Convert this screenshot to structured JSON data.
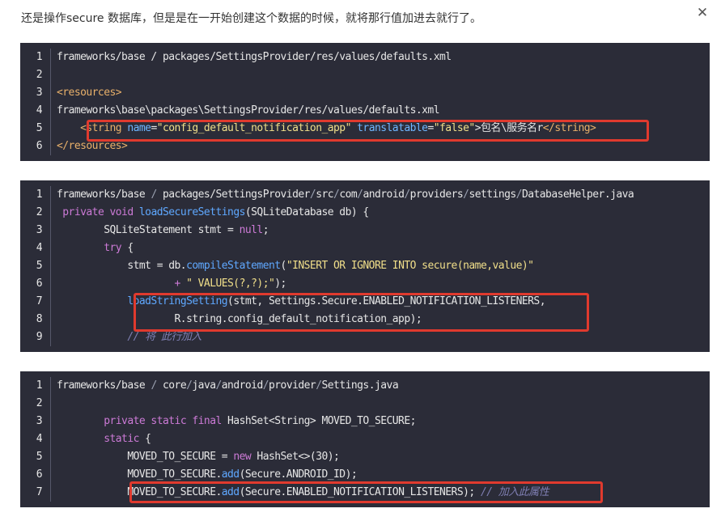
{
  "intro_text": "还是操作secure 数据库，但是是在一开始创建这个数据的时候，就将那行值加进去就行了。",
  "close_icon_glyph": "✕",
  "colors": {
    "code_bg": "#2b2c38",
    "highlight_border": "#e03a2e",
    "keyword": "#cc7ad6",
    "function": "#5fa8ff",
    "string": "#f1df8a",
    "comment": "#7f7fb3"
  },
  "blocks": [
    {
      "lines": [
        {
          "n": "1",
          "tokens": [
            {
              "t": "frameworks/base / packages/SettingsProvider/res/values/defaults.xml",
              "c": "t"
            }
          ]
        },
        {
          "n": "2",
          "tokens": []
        },
        {
          "n": "3",
          "tokens": [
            {
              "t": "<resources>",
              "c": "tag"
            }
          ]
        },
        {
          "n": "4",
          "tokens": [
            {
              "t": "frameworks\\base\\packages\\SettingsProvider/res/values/defaults.xml",
              "c": "t"
            }
          ]
        },
        {
          "n": "5",
          "tokens": [
            {
              "t": "    ",
              "c": "t"
            },
            {
              "t": "<string ",
              "c": "tag"
            },
            {
              "t": "name",
              "c": "at"
            },
            {
              "t": "=",
              "c": "t"
            },
            {
              "t": "\"config_default_notification_app\"",
              "c": "str"
            },
            {
              "t": " ",
              "c": "t"
            },
            {
              "t": "translatable",
              "c": "at"
            },
            {
              "t": "=",
              "c": "t"
            },
            {
              "t": "\"false\"",
              "c": "str"
            },
            {
              "t": ">包名\\服务名r",
              "c": "t"
            },
            {
              "t": "</string>",
              "c": "tag"
            }
          ]
        },
        {
          "n": "6",
          "tokens": [
            {
              "t": "</resources>",
              "c": "tag"
            }
          ]
        }
      ]
    },
    {
      "lines": [
        {
          "n": "1",
          "tokens": [
            {
              "t": "frameworks/base ",
              "c": "t"
            },
            {
              "t": "/",
              "c": "sl"
            },
            {
              "t": " packages/SettingsProvider",
              "c": "t"
            },
            {
              "t": "/",
              "c": "sl"
            },
            {
              "t": "src",
              "c": "t"
            },
            {
              "t": "/",
              "c": "sl"
            },
            {
              "t": "com",
              "c": "t"
            },
            {
              "t": "/",
              "c": "sl"
            },
            {
              "t": "android",
              "c": "t"
            },
            {
              "t": "/",
              "c": "sl"
            },
            {
              "t": "providers",
              "c": "t"
            },
            {
              "t": "/",
              "c": "sl"
            },
            {
              "t": "settings",
              "c": "t"
            },
            {
              "t": "/",
              "c": "sl"
            },
            {
              "t": "DatabaseHelper.java",
              "c": "t"
            }
          ]
        },
        {
          "n": "2",
          "tokens": [
            {
              "t": " ",
              "c": "t"
            },
            {
              "t": "private void ",
              "c": "kw"
            },
            {
              "t": "loadSecureSettings",
              "c": "fn"
            },
            {
              "t": "(SQLiteDatabase db) {",
              "c": "t"
            }
          ]
        },
        {
          "n": "3",
          "tokens": [
            {
              "t": "        SQLiteStatement stmt = ",
              "c": "t"
            },
            {
              "t": "null",
              "c": "kw"
            },
            {
              "t": ";",
              "c": "t"
            }
          ]
        },
        {
          "n": "4",
          "tokens": [
            {
              "t": "        ",
              "c": "t"
            },
            {
              "t": "try",
              "c": "kw"
            },
            {
              "t": " {",
              "c": "t"
            }
          ]
        },
        {
          "n": "5",
          "tokens": [
            {
              "t": "            stmt = db.",
              "c": "t"
            },
            {
              "t": "compileStatement",
              "c": "fn"
            },
            {
              "t": "(",
              "c": "t"
            },
            {
              "t": "\"INSERT OR IGNORE INTO secure(name,value)\"",
              "c": "str"
            }
          ]
        },
        {
          "n": "6",
          "tokens": [
            {
              "t": "                    + ",
              "c": "kw"
            },
            {
              "t": "\" VALUES(?,?);\"",
              "c": "str"
            },
            {
              "t": ");",
              "c": "t"
            }
          ]
        },
        {
          "n": "7",
          "tokens": [
            {
              "t": "            ",
              "c": "t"
            },
            {
              "t": "loadStringSetting",
              "c": "fn"
            },
            {
              "t": "(stmt, Settings.Secure.ENABLED_NOTIFICATION_LISTENERS,",
              "c": "t"
            }
          ]
        },
        {
          "n": "8",
          "tokens": [
            {
              "t": "                    R.string.config_default_notification_app);",
              "c": "t"
            }
          ]
        },
        {
          "n": "9",
          "tokens": [
            {
              "t": "            ",
              "c": "t"
            },
            {
              "t": "// 将 此行加入",
              "c": "cm"
            }
          ]
        }
      ]
    },
    {
      "lines": [
        {
          "n": "1",
          "tokens": [
            {
              "t": "frameworks/base ",
              "c": "t"
            },
            {
              "t": "/",
              "c": "sl"
            },
            {
              "t": " core",
              "c": "t"
            },
            {
              "t": "/",
              "c": "sl"
            },
            {
              "t": "java",
              "c": "t"
            },
            {
              "t": "/",
              "c": "sl"
            },
            {
              "t": "android",
              "c": "t"
            },
            {
              "t": "/",
              "c": "sl"
            },
            {
              "t": "provider",
              "c": "t"
            },
            {
              "t": "/",
              "c": "sl"
            },
            {
              "t": "Settings.java",
              "c": "t"
            }
          ]
        },
        {
          "n": "2",
          "tokens": []
        },
        {
          "n": "3",
          "tokens": [
            {
              "t": "        ",
              "c": "t"
            },
            {
              "t": "private static final ",
              "c": "kw"
            },
            {
              "t": "HashSet<String> MOVED_TO_SECURE;",
              "c": "t"
            }
          ]
        },
        {
          "n": "4",
          "tokens": [
            {
              "t": "        ",
              "c": "t"
            },
            {
              "t": "static",
              "c": "kw"
            },
            {
              "t": " {",
              "c": "t"
            }
          ]
        },
        {
          "n": "5",
          "tokens": [
            {
              "t": "            MOVED_TO_SECURE = ",
              "c": "t"
            },
            {
              "t": "new ",
              "c": "kw"
            },
            {
              "t": "HashSet<>(30);",
              "c": "t"
            }
          ]
        },
        {
          "n": "6",
          "tokens": [
            {
              "t": "            MOVED_TO_SECURE.",
              "c": "t"
            },
            {
              "t": "add",
              "c": "fn"
            },
            {
              "t": "(Secure.ANDROID_ID);",
              "c": "t"
            }
          ]
        },
        {
          "n": "7",
          "tokens": [
            {
              "t": "            MOVED_TO_SECURE.",
              "c": "t"
            },
            {
              "t": "add",
              "c": "fn"
            },
            {
              "t": "(Secure.ENABLED_NOTIFICATION_LISTENERS); ",
              "c": "t"
            },
            {
              "t": "// 加入此属性",
              "c": "cm"
            }
          ]
        }
      ]
    }
  ]
}
